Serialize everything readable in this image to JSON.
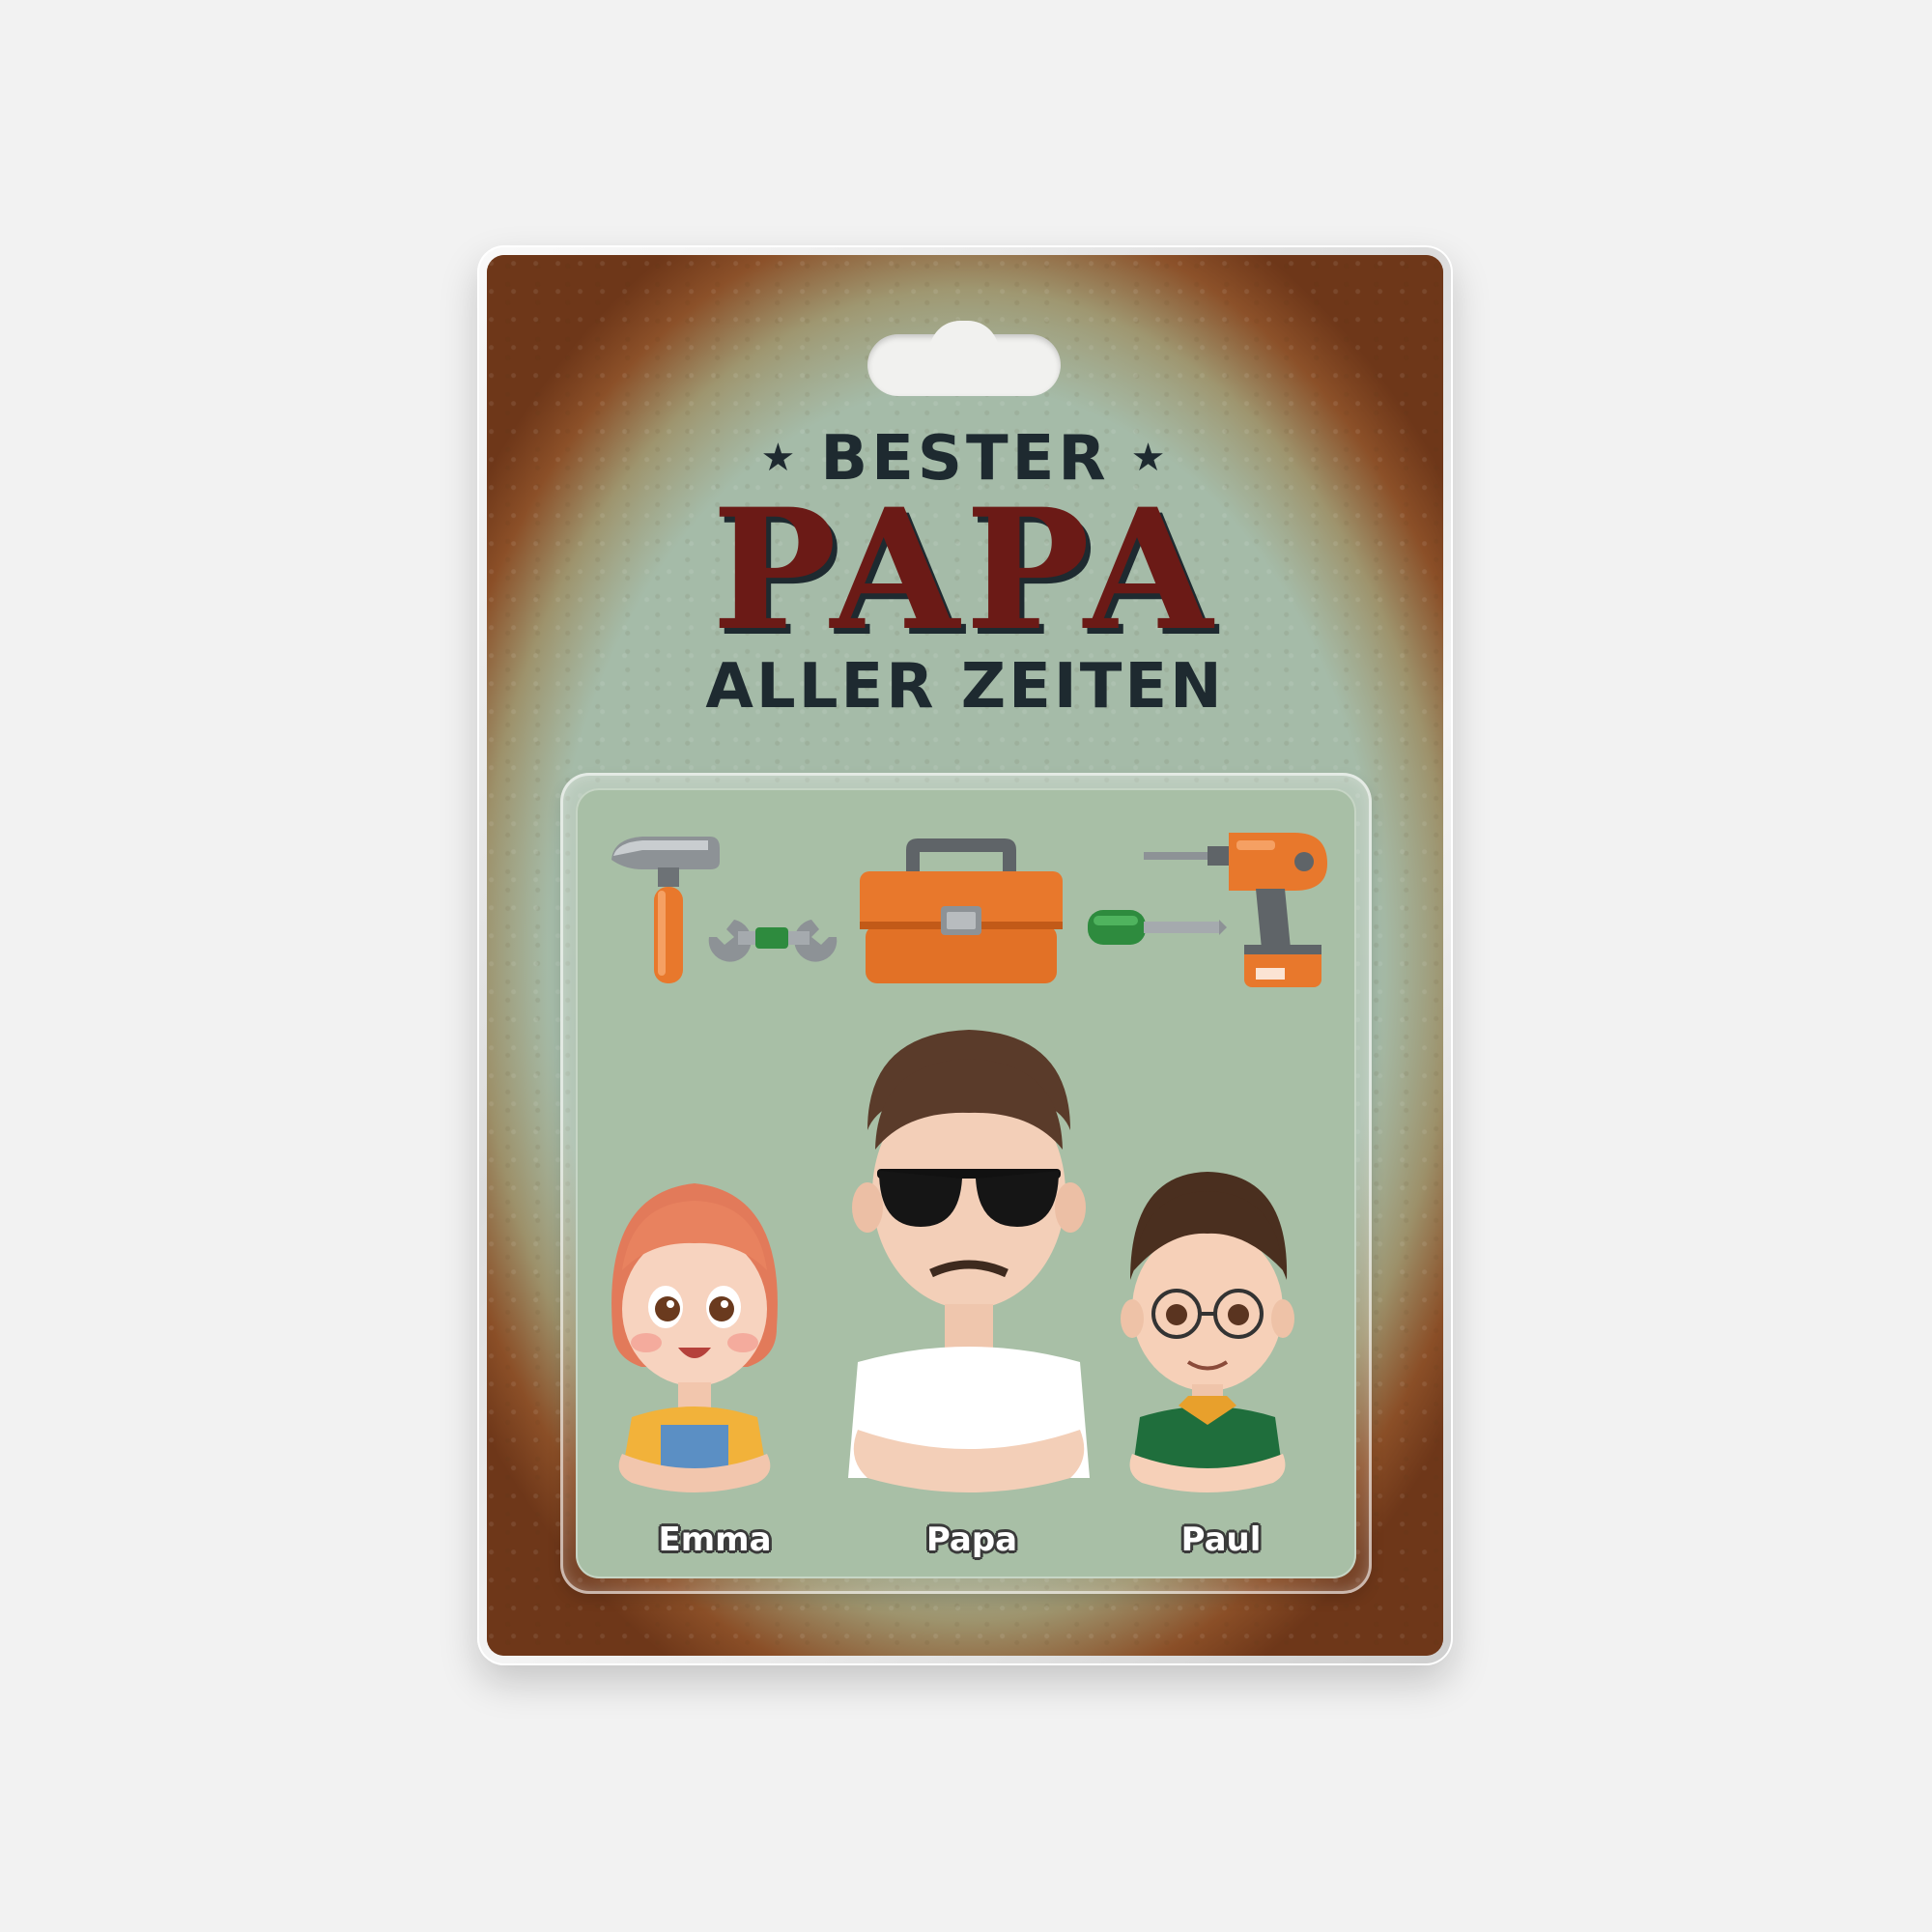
{
  "sign": {
    "line1": "BESTER",
    "line2": "PAPA",
    "line3": "ALLER ZEITEN",
    "star": "★"
  },
  "tools": [
    "hammer-icon",
    "wrench-icon",
    "toolbox-icon",
    "screwdriver-icon",
    "drill-icon"
  ],
  "people": [
    {
      "name": "Emma"
    },
    {
      "name": "Papa"
    },
    {
      "name": "Paul"
    }
  ],
  "colors": {
    "card_green": "#a8bfa6",
    "rust": "#6b3316",
    "title_red": "#6b1a16",
    "title_dark": "#1e2a30",
    "tool_orange": "#e8782c",
    "tool_green": "#2e8b3e"
  }
}
